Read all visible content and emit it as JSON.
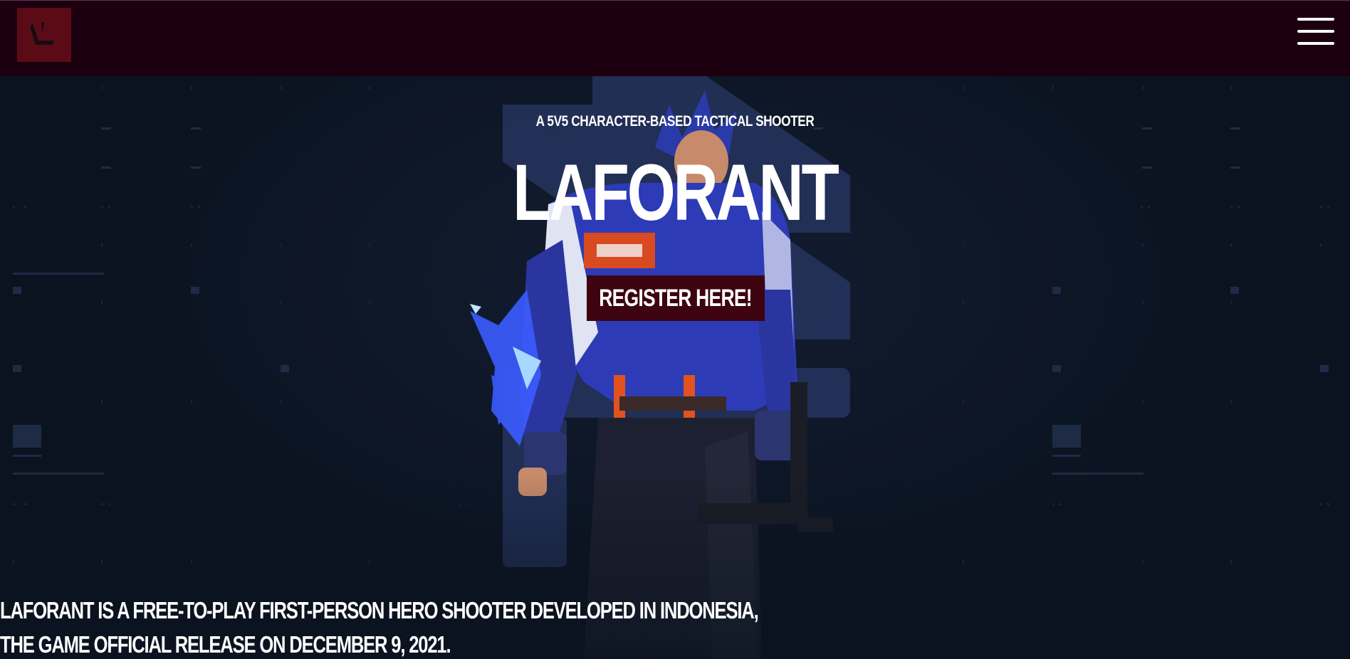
{
  "header": {
    "logo_icon": "laforant-logo-icon",
    "menu_icon": "hamburger-menu-icon"
  },
  "hero": {
    "tagline": "A 5V5 CHARACTER-BASED TACTICAL SHOOTER",
    "title": "LAFORANT",
    "register_label": "REGISTER HERE!",
    "description_line1": "LAFORANT IS A FREE-TO-PLAY FIRST-PERSON HERO SHOOTER DEVELOPED IN INDONESIA,",
    "description_line2": "THE GAME OFFICIAL RELEASE ON DECEMBER 9, 2021.",
    "artwork": "agent-character-artwork"
  },
  "colors": {
    "header_bg": "#1d0010",
    "page_bg": "#0b1320",
    "button_bg": "#3d0410",
    "accent_blue": "#2e3f74",
    "text": "#ffffff"
  }
}
